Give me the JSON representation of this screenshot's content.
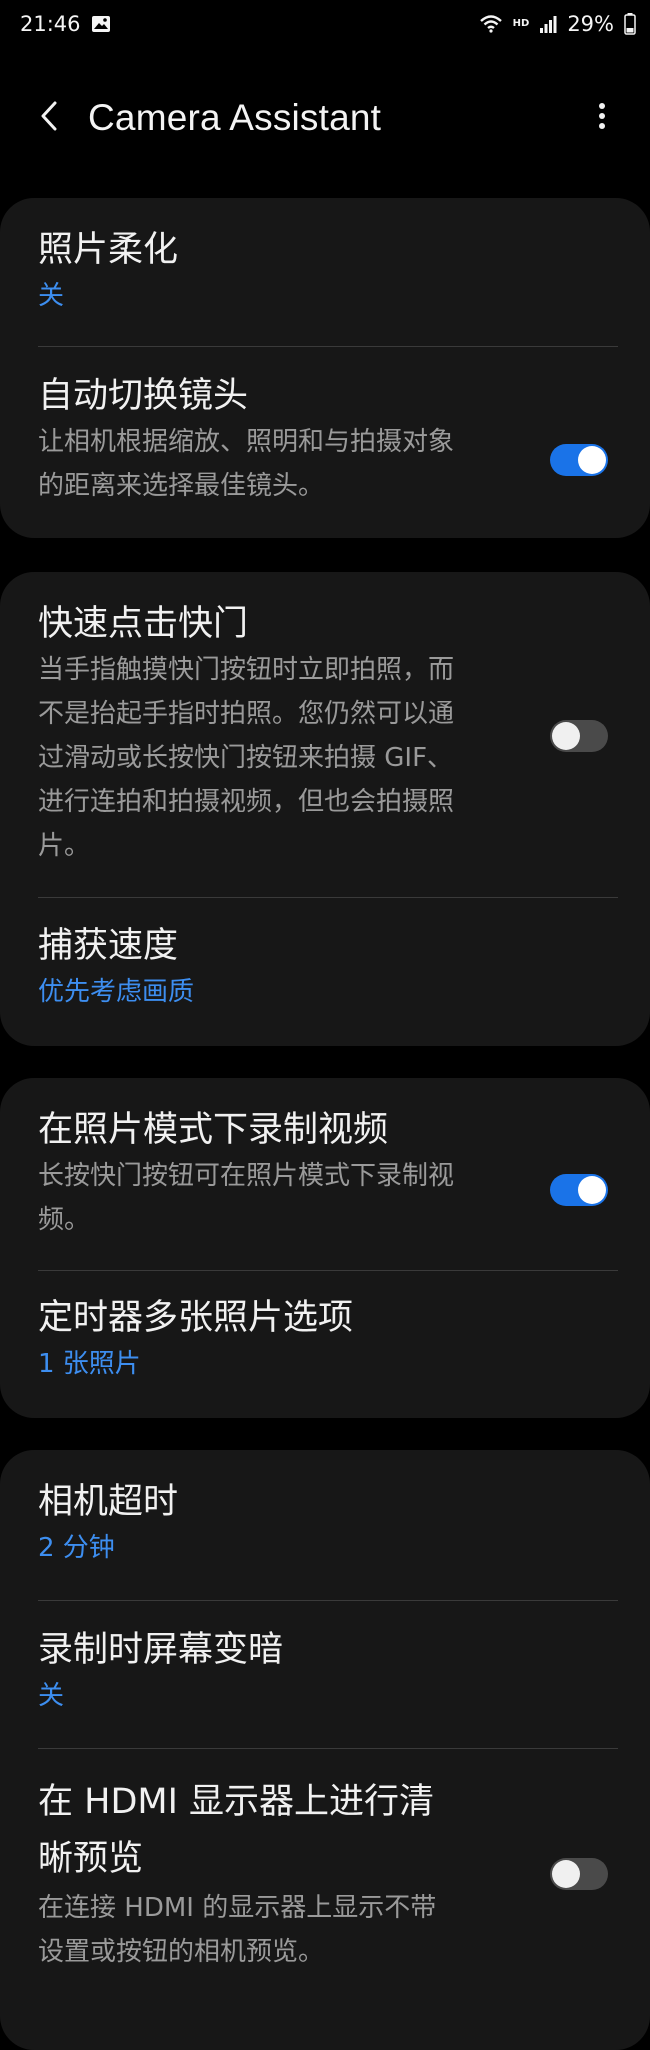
{
  "status_bar": {
    "time": "21:46",
    "hd_label": "HD",
    "battery": "29%"
  },
  "header": {
    "title": "Camera Assistant",
    "back_icon": "back-arrow-icon",
    "more_icon": "more-vertical-icon"
  },
  "groups": [
    {
      "items": [
        {
          "title": "照片柔化",
          "value": "关"
        },
        {
          "title": "自动切换镜头",
          "desc_lines": [
            "让相机根据缩放、照明和与拍摄对象",
            "的距离来选择最佳镜头。"
          ],
          "toggle": true
        }
      ]
    },
    {
      "items": [
        {
          "title": "快速点击快门",
          "desc_lines": [
            "当手指触摸快门按钮时立即拍照，而",
            "不是抬起手指时拍照。您仍然可以通",
            "过滑动或长按快门按钮来拍摄 GIF、",
            "进行连拍和拍摄视频，但也会拍摄照",
            "片。"
          ],
          "toggle": false
        },
        {
          "title": "捕获速度",
          "value": "优先考虑画质"
        }
      ]
    },
    {
      "items": [
        {
          "title": "在照片模式下录制视频",
          "desc_lines": [
            "长按快门按钮可在照片模式下录制视",
            "频。"
          ],
          "toggle": true
        },
        {
          "title": "定时器多张照片选项",
          "value": "1 张照片"
        }
      ]
    },
    {
      "items": [
        {
          "title": "相机超时",
          "value": "2 分钟"
        },
        {
          "title": "录制时屏幕变暗",
          "value": "关"
        },
        {
          "title_lines": [
            "在 HDMI 显示器上进行清",
            "晰预览"
          ],
          "desc_lines": [
            "在连接 HDMI 的显示器上显示不带",
            "设置或按钮的相机预览。"
          ],
          "toggle": false
        }
      ]
    }
  ],
  "colors": {
    "accent": "#3d8ef0",
    "switch_on": "#1a73e8",
    "card_bg": "#171717"
  }
}
